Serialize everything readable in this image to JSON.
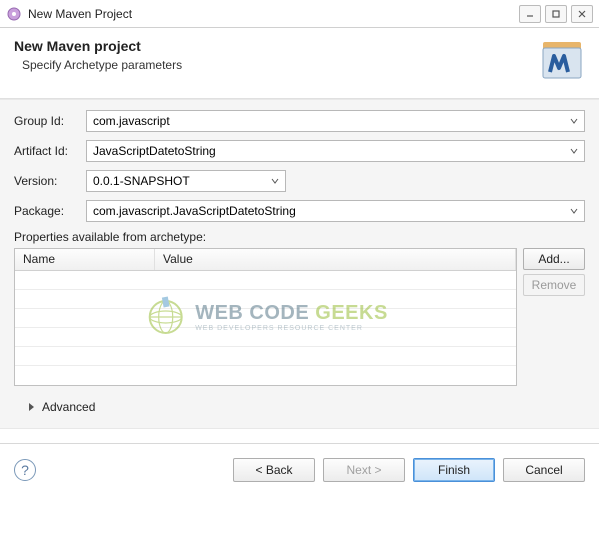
{
  "titlebar": {
    "title": "New Maven Project"
  },
  "header": {
    "title": "New Maven project",
    "subtitle": "Specify Archetype parameters"
  },
  "form": {
    "groupId": {
      "label": "Group Id:",
      "value": "com.javascript"
    },
    "artifactId": {
      "label": "Artifact Id:",
      "value": "JavaScriptDatetoString"
    },
    "version": {
      "label": "Version:",
      "value": "0.0.1-SNAPSHOT"
    },
    "package": {
      "label": "Package:",
      "value": "com.javascript.JavaScriptDatetoString"
    }
  },
  "properties": {
    "label": "Properties available from archetype:",
    "columns": {
      "name": "Name",
      "value": "Value"
    },
    "rows": [],
    "buttons": {
      "add": "Add...",
      "remove": "Remove"
    }
  },
  "advanced": {
    "label": "Advanced"
  },
  "footer": {
    "back": "< Back",
    "next": "Next >",
    "finish": "Finish",
    "cancel": "Cancel"
  },
  "watermark": {
    "line1_a": "WEB CODE ",
    "line1_b": "GEEKS",
    "line2": "WEB DEVELOPERS RESOURCE CENTER"
  }
}
